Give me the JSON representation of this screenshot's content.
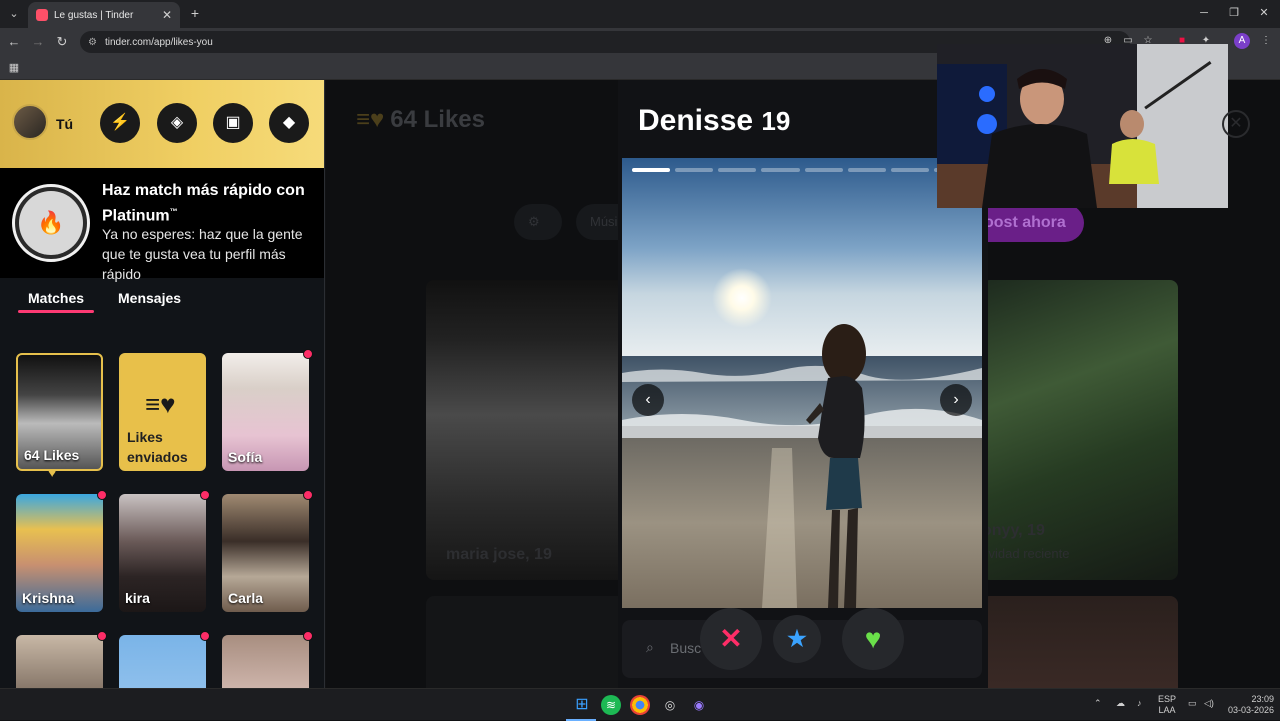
{
  "browser": {
    "tab_title": "Le gustas | Tinder",
    "url": "tinder.com/app/likes-you"
  },
  "header": {
    "me_label": "Tú"
  },
  "promo": {
    "title": "Haz match más rápido con Platinum",
    "title_mark": "™",
    "description": "Ya no esperes: haz que la gente que te gusta vea tu perfil más rápido"
  },
  "tabs": {
    "matches": "Matches",
    "messages": "Mensajes"
  },
  "grid": {
    "likes_label": "64 Likes",
    "sent_label_1": "Likes",
    "sent_label_2": "enviados",
    "people": [
      "Sofía",
      "Krishna",
      "kira",
      "Carla"
    ]
  },
  "main": {
    "likes_count": "64 Likes",
    "filter_music": "Músi",
    "boost": "oost ahora",
    "card1_name": "maria jose, 19",
    "card2_name": "onyy, 19",
    "card2_sub": "tividad reciente"
  },
  "profile": {
    "name": "Denisse",
    "age": "19",
    "search_placeholder": "Busc"
  },
  "taskbar": {
    "lang": "ESP",
    "lang2": "LAA",
    "time": "23:09",
    "date": "03-03-2026"
  },
  "colors": {
    "brand": "#fd3a73",
    "gold": "#e6c04c",
    "boost_purple": "#b34cff"
  }
}
